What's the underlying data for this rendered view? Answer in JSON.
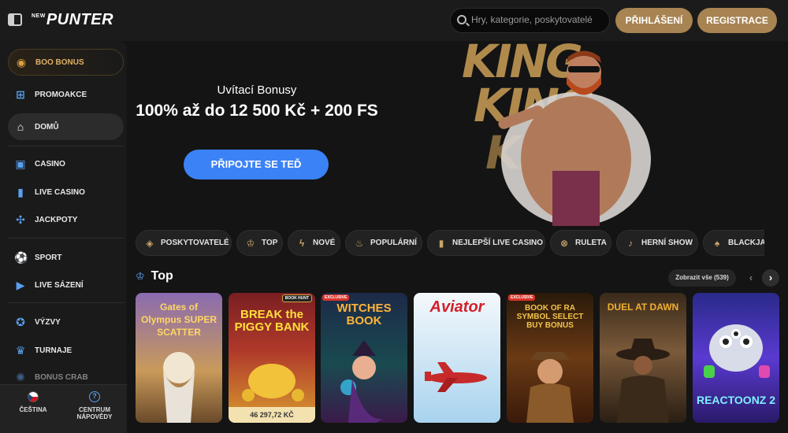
{
  "header": {
    "logo_prefix": "NEW",
    "logo": "PUNTER",
    "search_placeholder": "Hry, kategorie, poskytovatelé",
    "login_label": "PŘIHLÁŠENÍ",
    "register_label": "REGISTRACE"
  },
  "sidebar": {
    "items": [
      {
        "label": "BOO BONUS",
        "icon": "pumpkin-icon"
      },
      {
        "label": "PROMOAKCE",
        "icon": "gift-icon"
      },
      {
        "label": "DOMŮ",
        "icon": "home-icon"
      },
      {
        "label": "CASINO",
        "icon": "slot-machine-icon"
      },
      {
        "label": "LIVE CASINO",
        "icon": "card-icon"
      },
      {
        "label": "JACKPOTY",
        "icon": "clover-icon"
      },
      {
        "label": "SPORT",
        "icon": "football-icon"
      },
      {
        "label": "LIVE SÁZENÍ",
        "icon": "video-icon"
      },
      {
        "label": "VÝZVY",
        "icon": "medal-icon"
      },
      {
        "label": "TURNAJE",
        "icon": "trophy-icon"
      },
      {
        "label": "BONUS CRAB",
        "icon": "crab-icon"
      }
    ],
    "language_label": "ČEŠTINA",
    "help_label": "CENTRUM NÁPOVĚDY"
  },
  "hero": {
    "subtitle": "Uvítací Bonusy",
    "title": "100% až do 12 500 Kč + 200 FS",
    "cta_label": "PŘIPOJTE SE TEĎ",
    "bg_words": [
      "KING",
      "KING",
      "KING"
    ]
  },
  "categories": [
    {
      "label": "POSKYTOVATELÉ",
      "icon": "layers-icon"
    },
    {
      "label": "TOP",
      "icon": "crown-icon"
    },
    {
      "label": "NOVÉ",
      "icon": "lightning-icon"
    },
    {
      "label": "POPULÁRNÍ",
      "icon": "flame-icon"
    },
    {
      "label": "NEJLEPŠÍ LIVE CASINO",
      "icon": "card-icon"
    },
    {
      "label": "RULETA",
      "icon": "roulette-icon"
    },
    {
      "label": "HERNÍ SHOW",
      "icon": "microphone-icon"
    },
    {
      "label": "BLACKJACK",
      "icon": "spade-icon"
    }
  ],
  "top_section": {
    "title": "Top",
    "see_all_label": "Zobrazit vše (539)"
  },
  "games": [
    {
      "name": "Gates of Olympus SUPER SCATTER",
      "badge": "",
      "jackpot": ""
    },
    {
      "name": "BREAK the PIGGY BANK",
      "badge": "BOOK HUNT",
      "jackpot": "46 297,72 KČ"
    },
    {
      "name": "WITCHES BOOK",
      "badge": "EXCLUSIVE",
      "jackpot": ""
    },
    {
      "name": "Aviator",
      "badge": "",
      "jackpot": ""
    },
    {
      "name": "BOOK OF RA SYMBOL SELECT BUY BONUS",
      "badge": "EXCLUSIVE",
      "jackpot": ""
    },
    {
      "name": "DUEL AT DAWN",
      "badge": "",
      "jackpot": ""
    },
    {
      "name": "REACTOONZ 2",
      "badge": "",
      "jackpot": ""
    }
  ],
  "colors": {
    "accent_gold": "#a88452",
    "accent_blue": "#3b82f6",
    "background": "#141414",
    "sidebar_icon": "#5aa0f0"
  }
}
